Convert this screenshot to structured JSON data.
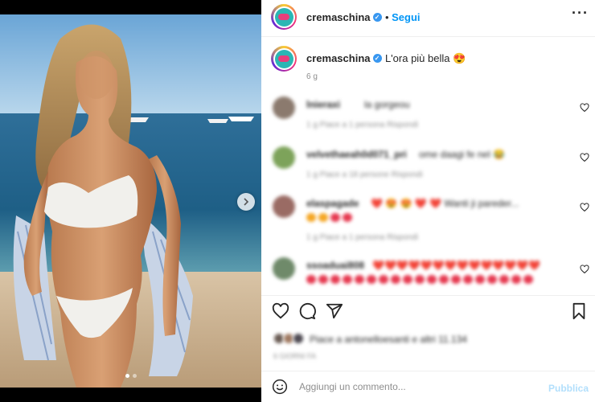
{
  "post": {
    "username": "cremaschina",
    "follow_label": "Segui",
    "more_icon": "more-horizontal-icon",
    "verified_icon": "verified-badge-icon"
  },
  "caption": {
    "username": "cremaschina",
    "text": "L'ora più bella 😍",
    "time": "6 g"
  },
  "comments": [
    {
      "name": "lnieraxi",
      "text": "la gorgeou",
      "meta": "1 g   Piace a 1 persona   Rispondi"
    },
    {
      "name": "velvethaeah0d071_pri",
      "text": "ome daagi fe nel 😂",
      "meta": "1 g   Piace a 18 persone   Rispondi"
    },
    {
      "name": "elaspagade",
      "text": "❤️ 😍 😍 ❤️ ❤️ Wanti ji pareder...",
      "meta": "1 g   Piace a 1 persona   Rispondi"
    },
    {
      "name": "ssoaduai808",
      "text": "❤️❤️❤️❤️❤️❤️❤️❤️❤️❤️❤️❤️❤️❤️",
      "meta": ""
    }
  ],
  "actions": {
    "like_icon": "heart-icon",
    "comment_icon": "comment-icon",
    "share_icon": "send-icon",
    "save_icon": "bookmark-icon"
  },
  "likes": {
    "text": "Piace a antonelloesanti e altri 11.134",
    "date": "6 GIORNI FA"
  },
  "comment_box": {
    "placeholder": "Aggiungi un commento...",
    "publish_label": "Pubblica",
    "emoji_icon": "smiley-icon"
  },
  "carousel": {
    "next_icon": "chevron-right-icon",
    "total_slides": 2,
    "active_slide": 1
  },
  "colors": {
    "accent": "#0095f6",
    "publish_disabled": "#b2dffc",
    "heart_red": "#ed4956"
  }
}
